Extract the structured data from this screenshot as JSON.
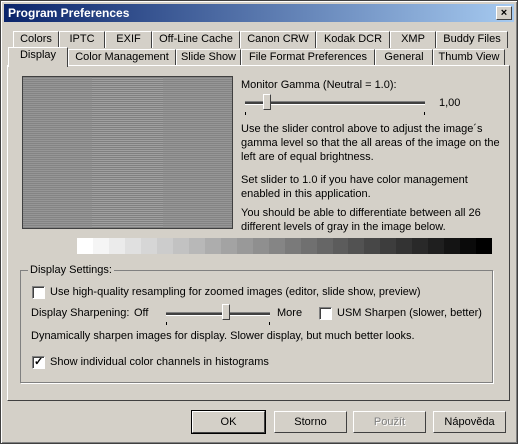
{
  "window": {
    "title": "Program Preferences",
    "close_symbol": "×"
  },
  "tabs_back": [
    "Colors",
    "IPTC",
    "EXIF",
    "Off-Line Cache",
    "Canon CRW",
    "Kodak DCR",
    "XMP",
    "Buddy Files"
  ],
  "tabs_front": [
    "Display",
    "Color Management",
    "Slide Show",
    "File Format Preferences",
    "General",
    "Thumb View"
  ],
  "active_tab": "Display",
  "gamma": {
    "label": "Monitor Gamma (Neutral = 1.0):",
    "value_text": "1,00",
    "slider_fraction": 0.12,
    "description": [
      "Use the slider control above to adjust the image´s",
      "gamma level so that the all areas of the image on the",
      "left are of equal brightness."
    ],
    "note": [
      "Set slider to 1.0 if you have color management",
      "enabled in this application."
    ],
    "note2": [
      "You should be able to differentiate between all 26",
      "different levels of gray in the image below."
    ],
    "gray_levels": 26
  },
  "display_settings": {
    "group_title": "Display Settings:",
    "hq_resampling_label": "Use high-quality resampling for zoomed images (editor, slide show, preview)",
    "hq_resampling_checked": false,
    "sharpening_label": "Display Sharpening:",
    "sharpening_off": "Off",
    "sharpening_more": "More",
    "sharpening_fraction": 0.58,
    "usm_label": "USM Sharpen (slower, better)",
    "usm_checked": false,
    "sharpen_description": "Dynamically sharpen images for display. Slower display, but much better looks.",
    "channels_label": "Show individual color channels in histograms",
    "channels_checked": true,
    "check_symbol": "✓"
  },
  "buttons": {
    "ok": "OK",
    "cancel": "Storno",
    "apply": "Použít",
    "help": "Nápověda"
  }
}
